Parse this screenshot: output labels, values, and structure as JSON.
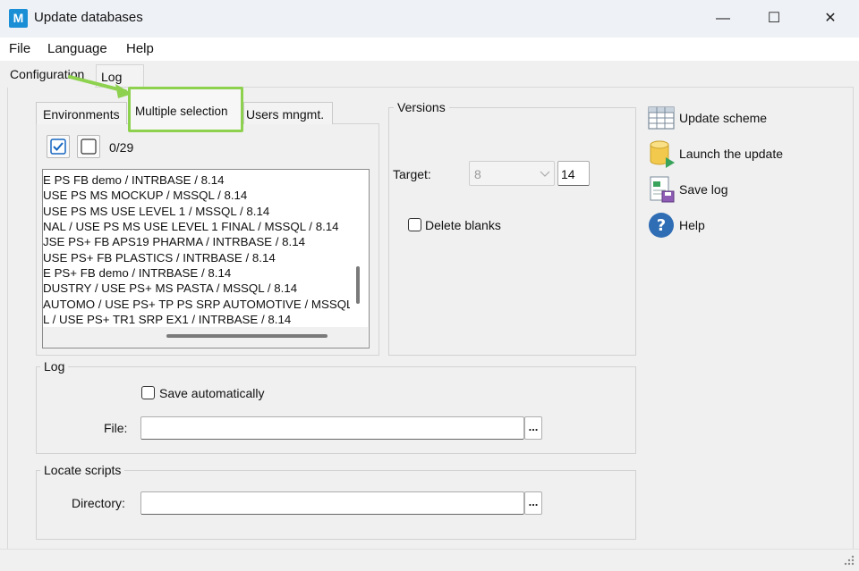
{
  "window": {
    "title": "Update databases",
    "app_icon_letter": "M",
    "controls": {
      "minimize": "—",
      "maximize": "☐",
      "close": "✕"
    }
  },
  "menu": [
    {
      "label": "File"
    },
    {
      "label": "Language"
    },
    {
      "label": "Help"
    }
  ],
  "outer_tabs": [
    {
      "label": "Configuration",
      "active": true
    },
    {
      "label": "Log",
      "active": false
    }
  ],
  "inner_tabs": [
    {
      "label": "Environments",
      "active": false
    },
    {
      "label": "Multiple selection",
      "active": true
    },
    {
      "label": "Users mngmt.",
      "active": false
    }
  ],
  "selection": {
    "check_all_icon": "checked-checkbox-icon",
    "uncheck_all_icon": "empty-checkbox-icon",
    "count": "0/29",
    "items": [
      "E PS FB demo / INTRBASE / 8.14",
      "USE PS MS MOCKUP / MSSQL / 8.14",
      "USE PS MS USE LEVEL 1 / MSSQL / 8.14",
      "NAL / USE PS MS USE LEVEL 1 FINAL / MSSQL / 8.14",
      "JSE PS+ FB APS19 PHARMA / INTRBASE / 8.14",
      "USE PS+ FB PLASTICS / INTRBASE / 8.14",
      "E PS+ FB demo / INTRBASE / 8.14",
      "DUSTRY / USE PS+ MS PASTA / MSSQL / 8.14",
      "AUTOMO / USE PS+ TP PS SRP AUTOMOTIVE / MSSQL",
      "L / USE PS+ TR1 SRP EX1 / INTRBASE / 8.14"
    ]
  },
  "versions": {
    "legend": "Versions",
    "target_label": "Target:",
    "target_major": "8",
    "target_minor": "14",
    "delete_blanks_label": "Delete blanks",
    "delete_blanks_checked": false
  },
  "log_group": {
    "legend": "Log",
    "save_auto_label": "Save automatically",
    "save_auto_checked": false,
    "file_label": "File:",
    "file_value": "",
    "browse_label": "..."
  },
  "scripts_group": {
    "legend": "Locate scripts",
    "directory_label": "Directory:",
    "directory_value": "",
    "browse_label": "..."
  },
  "actions": [
    {
      "label": "Update scheme",
      "icon": "grid-table-icon"
    },
    {
      "label": "Launch the update",
      "icon": "database-play-icon"
    },
    {
      "label": "Save log",
      "icon": "save-log-icon"
    },
    {
      "label": "Help",
      "icon": "help-question-icon"
    }
  ],
  "colors": {
    "highlight_green": "#8dd14f",
    "accent_blue": "#1a8fd6"
  }
}
